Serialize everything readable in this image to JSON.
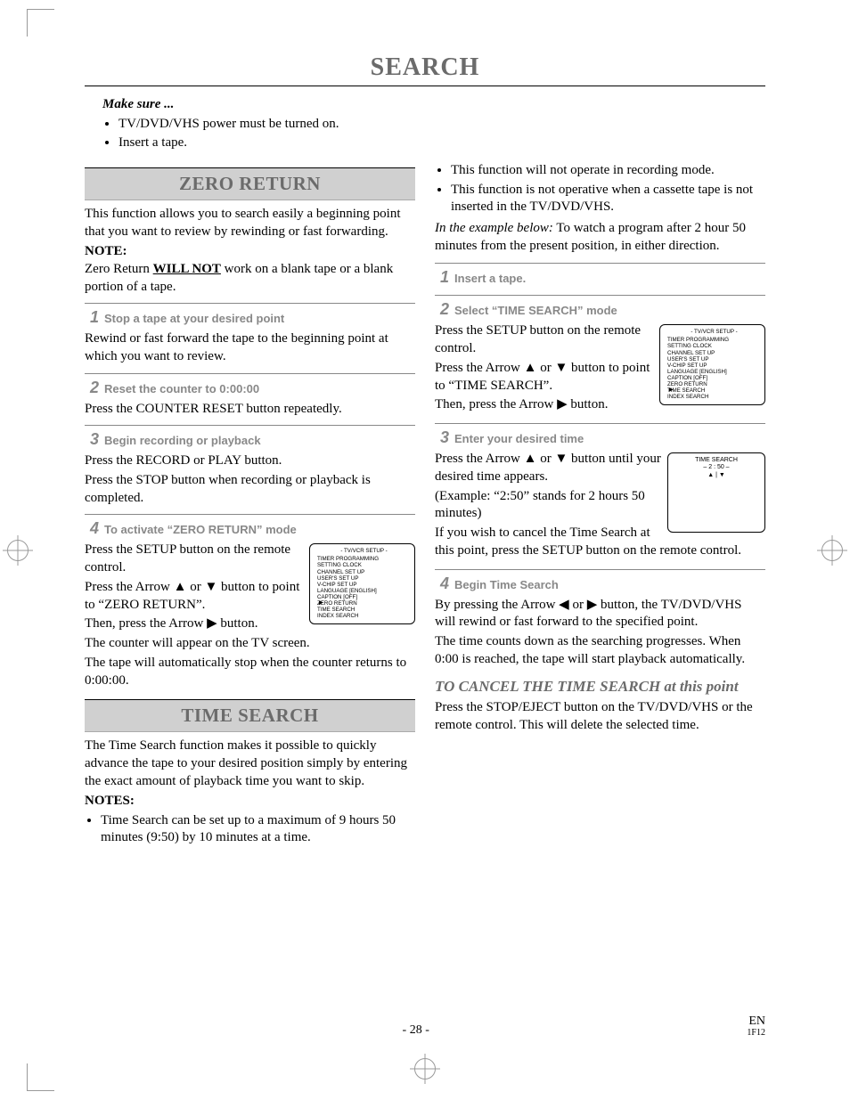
{
  "title": "SEARCH",
  "intro": {
    "label": "Make sure ...",
    "items": [
      "TV/DVD/VHS power must be turned on.",
      "Insert a tape."
    ]
  },
  "left": {
    "zero_return": {
      "heading": "ZERO RETURN",
      "desc": "This function allows you to search easily a beginning point that you want to review by rewinding or fast forwarding.",
      "note_label": "NOTE:",
      "note_pre": "Zero Return ",
      "note_bold": "WILL NOT",
      "note_post": " work on a blank tape or a blank portion of a tape.",
      "steps": [
        {
          "num": "1",
          "title": "Stop a tape at your desired point",
          "body": "Rewind or fast forward the tape to the beginning point at which you want to review."
        },
        {
          "num": "2",
          "title": "Reset the counter to 0:00:00",
          "body": "Press the COUNTER RESET button repeatedly."
        },
        {
          "num": "3",
          "title": "Begin recording or playback",
          "body1": "Press the RECORD or PLAY button.",
          "body2": "Press the STOP button when recording or playback is completed."
        },
        {
          "num": "4",
          "title": "To activate “ZERO RETURN” mode",
          "body1": "Press the SETUP button on the remote control.",
          "body2a": "Press the Arrow ",
          "body2b": " or ",
          "body2c": " button to point to “ZERO RETURN”.",
          "body3a": "Then, press the Arrow ",
          "body3b": " button.",
          "body4": "The counter will appear on the TV screen.",
          "body5": "The tape will automatically stop when the counter returns to 0:00:00."
        }
      ]
    },
    "time_search": {
      "heading": "TIME SEARCH",
      "desc": "The Time Search function makes it possible to quickly advance the tape to your desired position simply by entering the exact amount of playback time you want to skip.",
      "notes_label": "NOTES:",
      "notes": [
        "Time Search can be set up to a maximum of 9 hours 50 minutes (9:50) by 10 minutes at a time."
      ]
    }
  },
  "right": {
    "notes_cont": [
      "This function will not operate in recording mode.",
      "This function is not operative when a cassette tape is not inserted in the TV/DVD/VHS."
    ],
    "example_pre": "In the example below:",
    "example_post": " To watch a program after 2 hour 50 minutes from the present position, in either direction.",
    "steps": [
      {
        "num": "1",
        "title": "Insert a tape."
      },
      {
        "num": "2",
        "title": "Select “TIME SEARCH” mode",
        "body1": "Press the SETUP button on the remote control.",
        "body2a": "Press the Arrow ",
        "body2b": " or ",
        "body2c": " button to point to “TIME SEARCH”.",
        "body3a": "Then, press the Arrow ",
        "body3b": " button."
      },
      {
        "num": "3",
        "title": "Enter your desired time",
        "body1a": "Press the Arrow ",
        "body1b": " or ",
        "body1c": " button until your desired time appears.",
        "body2": "(Example: “2:50” stands for 2 hours 50 minutes)",
        "body3": "If you wish to cancel the Time Search at this point, press the SETUP button on the remote control."
      },
      {
        "num": "4",
        "title": "Begin Time Search",
        "body1a": "By pressing the Arrow ",
        "body1b": " or ",
        "body1c": " button, the TV/DVD/VHS will rewind or fast forward to the specified point.",
        "body2": "The time counts down as the searching progresses. When 0:00 is reached, the tape will start playback automatically."
      }
    ],
    "cancel_head": "TO CANCEL THE TIME SEARCH at this point",
    "cancel_body": "Press the STOP/EJECT button on the TV/DVD/VHS or the remote control. This will delete the selected time."
  },
  "osd": {
    "title": "- TV/VCR SETUP -",
    "items": [
      "TIMER PROGRAMMING",
      "SETTING CLOCK",
      "CHANNEL SET UP",
      "USER'S SET UP",
      "V-CHIP SET UP",
      "LANGUAGE  [ENGLISH]",
      "CAPTION  [OFF]",
      "ZERO RETURN",
      "TIME SEARCH",
      "INDEX SEARCH"
    ],
    "small_title": "TIME SEARCH",
    "small_val": "–  2 : 50  –",
    "small_arrows": "▲ | ▼"
  },
  "footer": {
    "page": "- 28 -",
    "lang": "EN",
    "code": "1F12"
  },
  "glyphs": {
    "up": "▲",
    "down": "▼",
    "left": "◀",
    "right": "▶"
  }
}
